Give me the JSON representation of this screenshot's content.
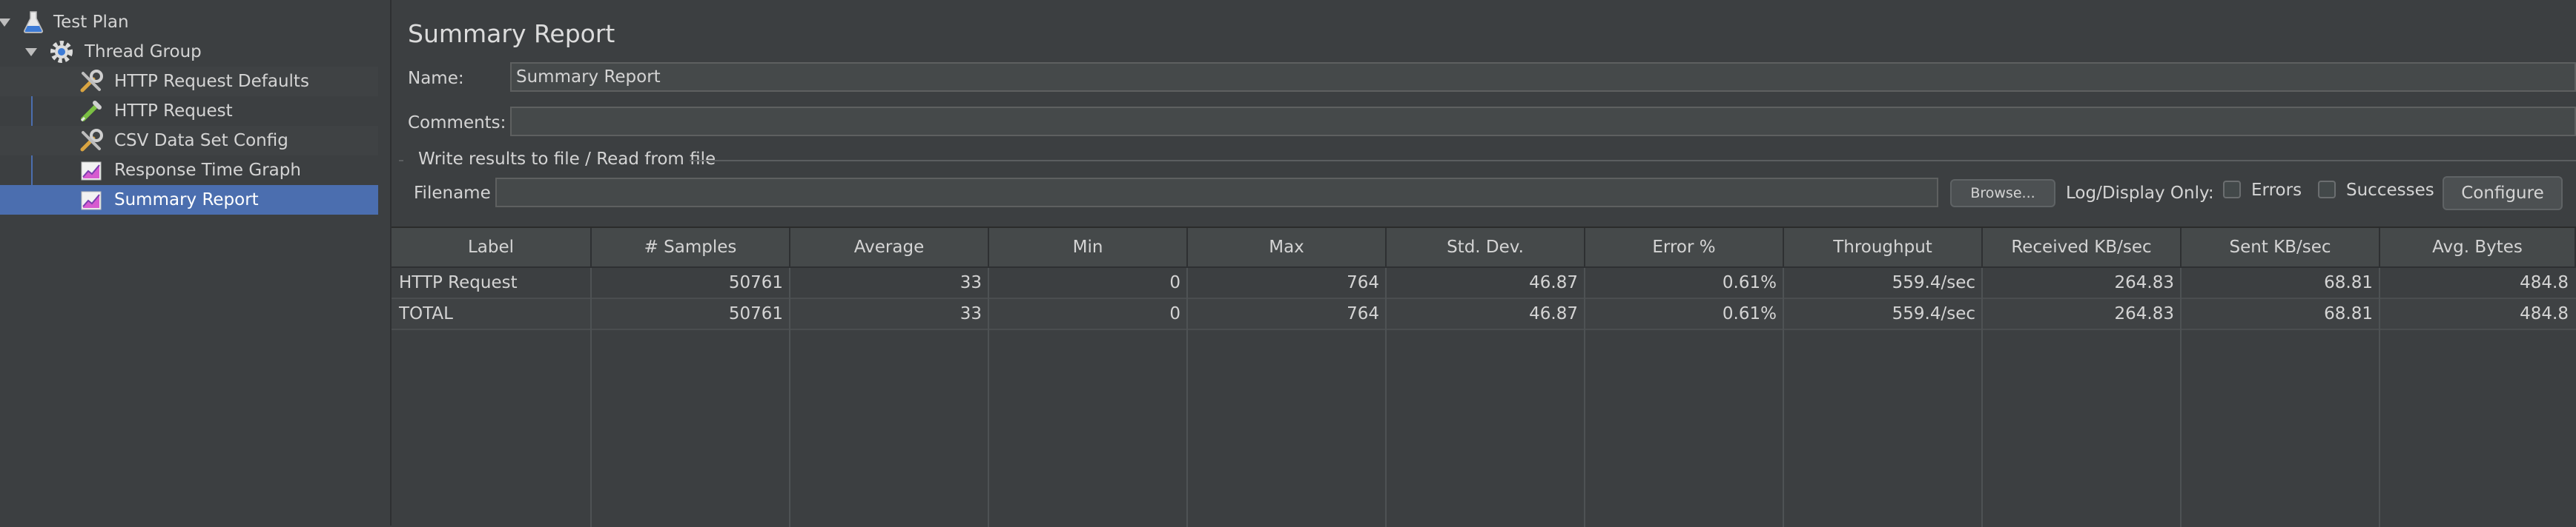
{
  "tree": {
    "items": [
      {
        "label": "Test Plan",
        "icon": "flask-icon"
      },
      {
        "label": "Thread Group",
        "icon": "gear-icon"
      },
      {
        "label": "HTTP Request Defaults",
        "icon": "wrench-icon"
      },
      {
        "label": "HTTP Request",
        "icon": "pipette-icon"
      },
      {
        "label": "CSV Data Set Config",
        "icon": "wrench-icon"
      },
      {
        "label": "Response Time Graph",
        "icon": "graph-icon"
      },
      {
        "label": "Summary Report",
        "icon": "graph-icon"
      }
    ],
    "selected": "Summary Report"
  },
  "panel": {
    "title": "Summary Report",
    "name_label": "Name:",
    "name_value": "Summary Report",
    "comments_label": "Comments:",
    "comments_value": "",
    "group_title": "Write results to file / Read from file",
    "filename_label": "Filename",
    "filename_value": "",
    "browse_label": "Browse...",
    "log_display_label": "Log/Display Only:",
    "errors_label": "Errors",
    "successes_label": "Successes",
    "configure_label": "Configure"
  },
  "table": {
    "columns": [
      "Label",
      "# Samples",
      "Average",
      "Min",
      "Max",
      "Std. Dev.",
      "Error %",
      "Throughput",
      "Received KB/sec",
      "Sent KB/sec",
      "Avg. Bytes"
    ],
    "rows": [
      [
        "HTTP Request",
        "50761",
        "33",
        "0",
        "764",
        "46.87",
        "0.61%",
        "559.4/sec",
        "264.83",
        "68.81",
        "484.8"
      ],
      [
        "TOTAL",
        "50761",
        "33",
        "0",
        "764",
        "46.87",
        "0.61%",
        "559.4/sec",
        "264.83",
        "68.81",
        "484.8"
      ]
    ]
  },
  "colors": {
    "background": "#3c3f41",
    "selection": "#4b6eaf",
    "text": "#d4d4d4"
  }
}
